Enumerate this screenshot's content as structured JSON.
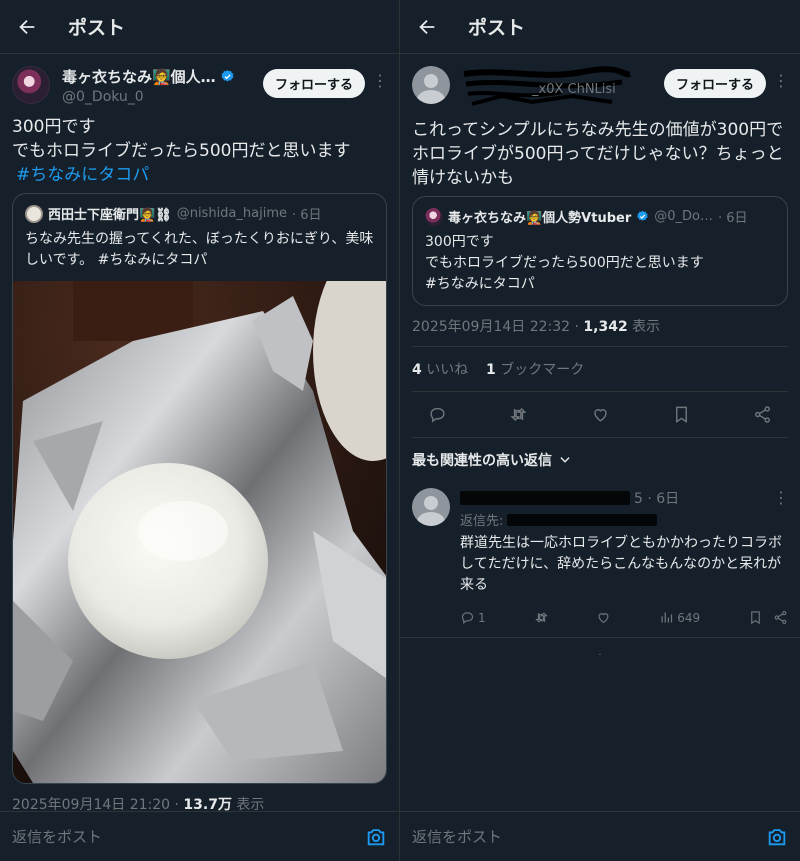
{
  "left": {
    "title": "ポスト",
    "author": {
      "name": "毒ヶ衣ちなみ🧑‍🏫個人…",
      "handle": "@0_Doku_0",
      "follow_label": "フォローする"
    },
    "post_line1": "300円です",
    "post_line2": "でもホロライブだったら500円だと思います",
    "post_hashtag": "#ちなみにタコパ",
    "quote": {
      "name": "西田士下座衛門🧑‍🏫⛓",
      "handle": "@nishida_hajime",
      "time": "· 6日",
      "text": "ちなみ先生の握ってくれた、ぼったくりおにぎり、美味しいです。 #ちなみにタコパ"
    },
    "timestamp": "2025年09月14日 21:20 · ",
    "views": "13.7万",
    "views_label": " 表示",
    "reply_placeholder": "返信をポスト"
  },
  "right": {
    "title": "ポスト",
    "author_handle_fragment": "_x0X ChNLisi",
    "follow_label": "フォローする",
    "post_text": "これってシンプルにちなみ先生の価値が300円でホロライブが500円ってだけじゃない？ちょっと情けないかも",
    "quote": {
      "name": "毒ヶ衣ちなみ🧑‍🏫個人勢Vtuber",
      "handle": "@0_Do…",
      "time": "· 6日",
      "line1": "300円です",
      "line2": "でもホロライブだったら500円だと思います",
      "line3": "#ちなみにタコパ"
    },
    "timestamp": "2025年09月14日 22:32 · ",
    "views": "1,342",
    "views_label": " 表示",
    "likes_count": "4",
    "likes_label": " いいね",
    "bookmarks_count": "1",
    "bookmarks_label": " ブックマーク",
    "sort_label": "最も関連性の高い返信",
    "reply": {
      "time": "5 · 6日",
      "reply_to_label": "返信先:",
      "text": "群道先生は一応ホロライブともかかわったりコラボしてただけに、辞めたらこんなもんなのかと呆れが来る",
      "reply_count": "1",
      "views": "649"
    },
    "reply_placeholder": "返信をポスト"
  },
  "colors": {
    "background": "#15202b",
    "accent": "#1d9bf0",
    "muted": "#71767b",
    "text": "#e7e9ea"
  },
  "icons": [
    "back-arrow-icon",
    "verified-badge-icon",
    "more-icon",
    "camera-icon",
    "reply-icon",
    "repost-icon",
    "like-icon",
    "bookmark-icon",
    "share-icon",
    "chevron-down-icon",
    "views-icon"
  ]
}
